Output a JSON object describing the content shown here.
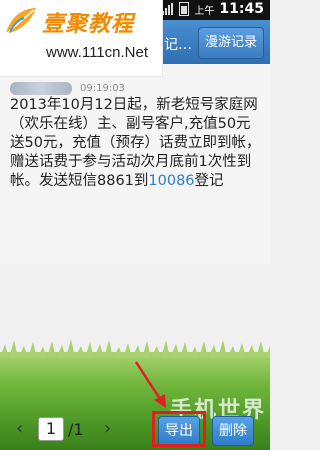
{
  "status_bar": {
    "ampm": "上午",
    "time": "11:45"
  },
  "logo": {
    "brand": "壹聚教程",
    "url": "www.111cn.Net"
  },
  "title_bar": {
    "title_fragment": "记…",
    "roam_button": "漫游记录"
  },
  "message": {
    "time": "09:19:03",
    "body_before_link": "2013年10月12日起，新老短号家庭网（欢乐在线）主、副号客户,充值50元送50元，充值（预存）话费立即到帐，赠送话费于参与活动次月底前1次性到帐。发送短信8861到",
    "link_number": "10086",
    "body_after_link": "登记"
  },
  "pager": {
    "current_page": "1",
    "total": "/1"
  },
  "actions": {
    "export": "导出",
    "delete": "删除"
  },
  "watermark": "手机世界",
  "colors": {
    "title_bar": "#2d6fb3",
    "link": "#2a7fd4",
    "highlight": "#e02020",
    "logo_orange": "#f08a00"
  }
}
